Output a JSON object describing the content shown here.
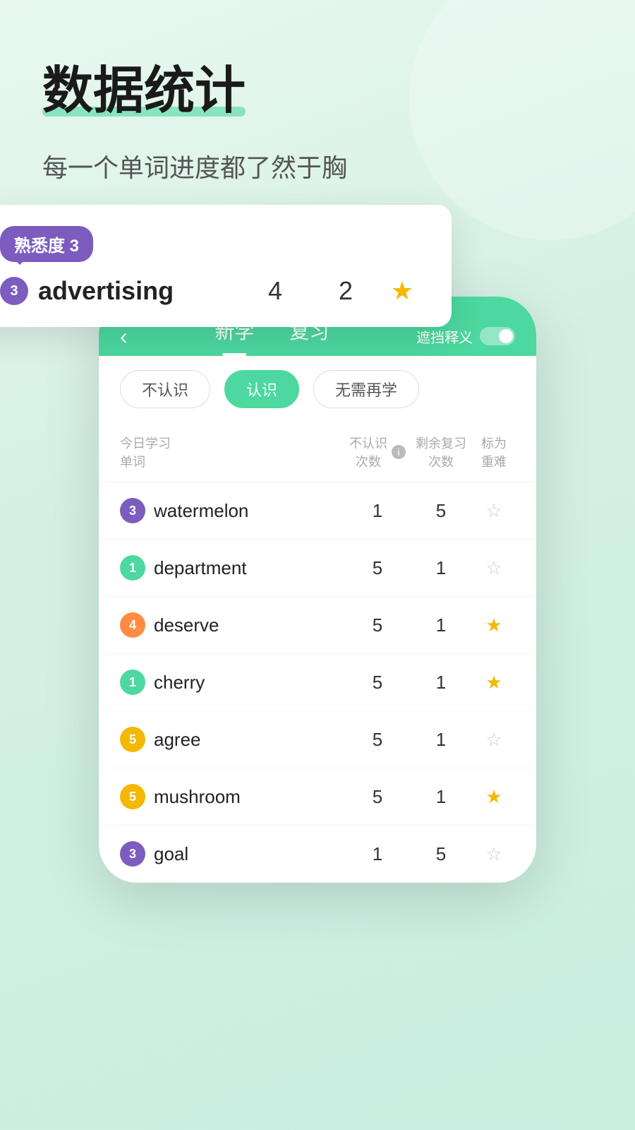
{
  "background": {
    "color": "#d4f0e4"
  },
  "header": {
    "title": "数据统计",
    "subtitle": "每一个单词进度都了然于胸"
  },
  "phone": {
    "nav": {
      "back_icon": "‹",
      "tab_new": "新学",
      "tab_review": "复习",
      "toggle_label": "遮挡释义"
    },
    "filter_buttons": [
      {
        "label": "不认识",
        "active": false
      },
      {
        "label": "认识",
        "active": true
      },
      {
        "label": "无需再学",
        "active": false
      }
    ],
    "table_header": {
      "col_today": "今日学习\n单词",
      "col_unknown": "不认识\n次数",
      "col_remaining": "剩余复习\n次数",
      "col_mark": "标为\n重难"
    }
  },
  "floating_card": {
    "familiarity_label": "熟悉度 3",
    "word": "advertising",
    "badge_num": "3",
    "badge_color": "purple",
    "unknown_count": "4",
    "remaining_count": "2",
    "is_starred": true
  },
  "word_list": [
    {
      "word": "watermelon",
      "badge_num": "3",
      "badge_color": "purple",
      "unknown": "1",
      "remaining": "5",
      "starred": false
    },
    {
      "word": "department",
      "badge_num": "1",
      "badge_color": "green",
      "unknown": "5",
      "remaining": "1",
      "starred": false
    },
    {
      "word": "deserve",
      "badge_num": "4",
      "badge_color": "orange",
      "unknown": "5",
      "remaining": "1",
      "starred": true
    },
    {
      "word": "cherry",
      "badge_num": "1",
      "badge_color": "green",
      "unknown": "5",
      "remaining": "1",
      "starred": true
    },
    {
      "word": "agree",
      "badge_num": "5",
      "badge_color": "yellow",
      "unknown": "5",
      "remaining": "1",
      "starred": false
    },
    {
      "word": "mushroom",
      "badge_num": "5",
      "badge_color": "yellow",
      "unknown": "5",
      "remaining": "1",
      "starred": true
    },
    {
      "word": "goal",
      "badge_num": "3",
      "badge_color": "purple",
      "unknown": "1",
      "remaining": "5",
      "starred": false
    }
  ]
}
